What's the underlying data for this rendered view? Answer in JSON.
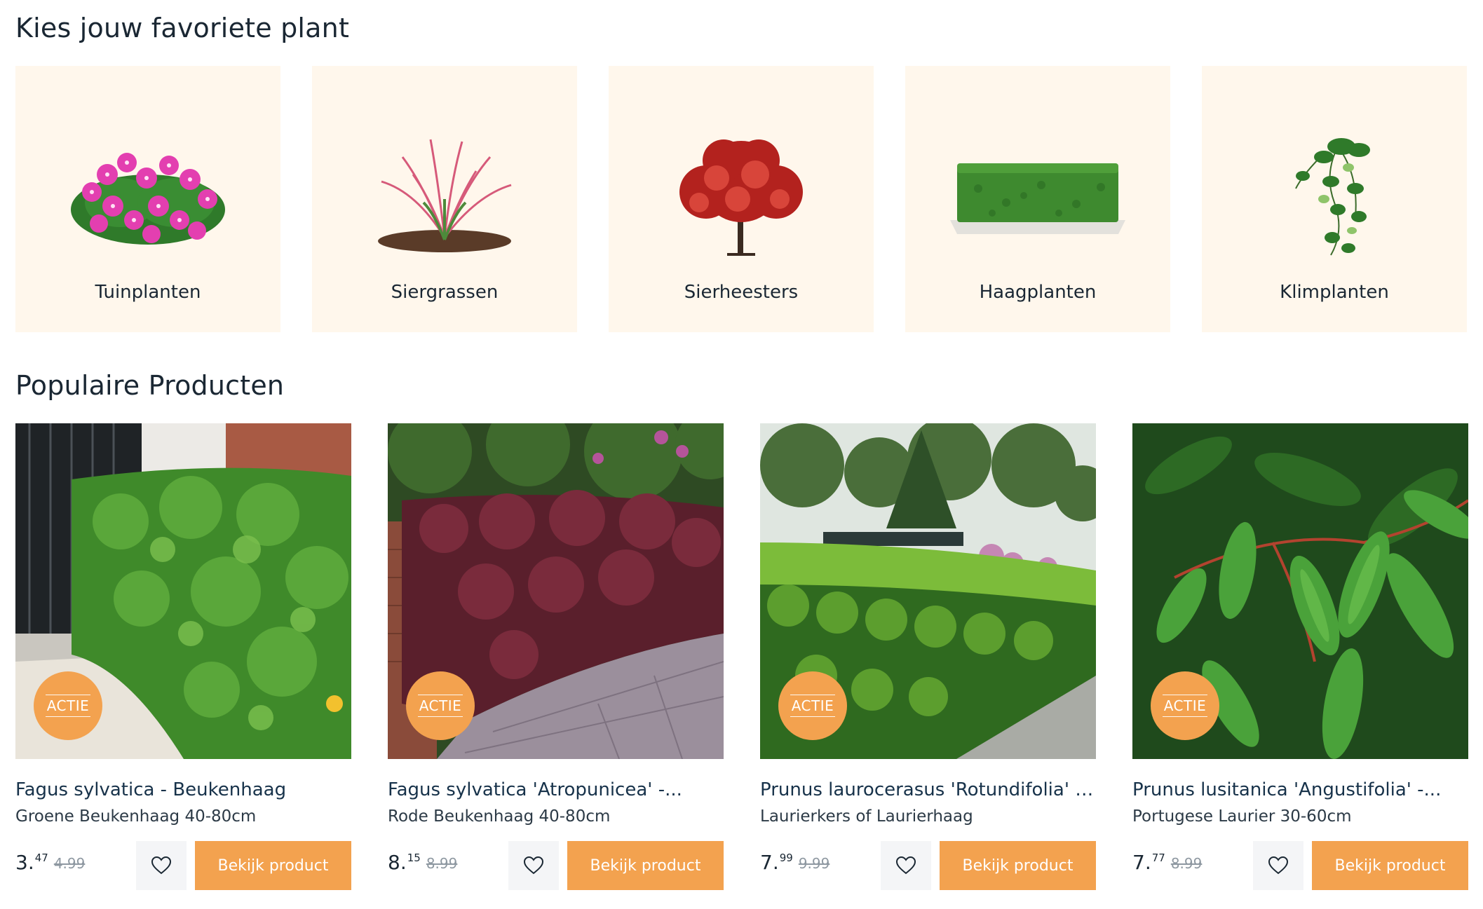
{
  "categories_section": {
    "title": "Kies jouw favoriete plant"
  },
  "categories": [
    {
      "label": "Tuinplanten",
      "icon": "flowering-plant-icon"
    },
    {
      "label": "Siergrassen",
      "icon": "ornamental-grass-icon"
    },
    {
      "label": "Sierheesters",
      "icon": "red-tree-icon"
    },
    {
      "label": "Haagplanten",
      "icon": "hedge-icon"
    },
    {
      "label": "Klimplanten",
      "icon": "climbing-plant-icon"
    }
  ],
  "products_section": {
    "title": "Populaire Producten"
  },
  "products": [
    {
      "badge": "ACTIE",
      "name": "Fagus sylvatica - Beukenhaag",
      "subtitle": "Groene Beukenhaag 40-80cm",
      "price_int": "3.",
      "price_dec": "47",
      "old_price": "4.99",
      "button": "Bekijk product",
      "image": "green-beech-hedge-photo",
      "fav_icon": "heart-icon"
    },
    {
      "badge": "ACTIE",
      "name": "Fagus sylvatica 'Atropunicea' -...",
      "subtitle": "Rode Beukenhaag 40-80cm",
      "price_int": "8.",
      "price_dec": "15",
      "old_price": "8.99",
      "button": "Bekijk product",
      "image": "red-beech-hedge-photo",
      "fav_icon": "heart-icon"
    },
    {
      "badge": "ACTIE",
      "name": "Prunus laurocerasus 'Rotundifolia' -...",
      "subtitle": "Laurierkers of Laurierhaag",
      "price_int": "7.",
      "price_dec": "99",
      "old_price": "9.99",
      "button": "Bekijk product",
      "image": "cherry-laurel-hedge-photo",
      "fav_icon": "heart-icon"
    },
    {
      "badge": "ACTIE",
      "name": "Prunus lusitanica 'Angustifolia' -...",
      "subtitle": "Portugese Laurier 30-60cm",
      "price_int": "7.",
      "price_dec": "77",
      "old_price": "8.99",
      "button": "Bekijk product",
      "image": "portuguese-laurel-leaves-photo",
      "fav_icon": "heart-icon"
    }
  ],
  "colors": {
    "accent": "#f3a24f",
    "tile_bg": "#fff7ec",
    "text": "#1a2733",
    "fav_bg": "#f4f5f7"
  }
}
